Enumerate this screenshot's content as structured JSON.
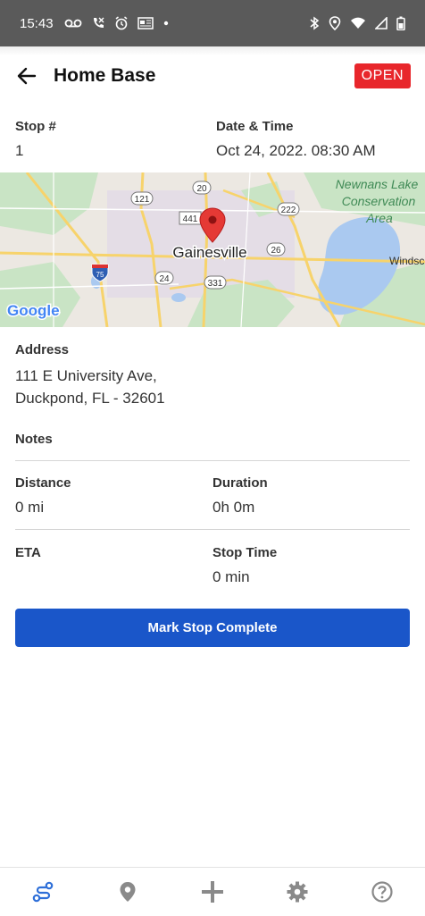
{
  "statusbar": {
    "time": "15:43"
  },
  "appbar": {
    "title": "Home Base",
    "status_badge": "OPEN"
  },
  "stop": {
    "label": "Stop #",
    "value": "1"
  },
  "datetime": {
    "label": "Date & Time",
    "value": "Oct 24, 2022. 08:30 AM"
  },
  "map": {
    "city": "Gainesville",
    "lake_label_1": "Newnans Lake",
    "lake_label_2": "Conservation",
    "lake_label_3": "Area",
    "place_right": "Windsc",
    "shields": [
      "121",
      "20",
      "441",
      "222",
      "26",
      "24",
      "331",
      "75"
    ],
    "logo": "Google"
  },
  "address": {
    "label": "Address",
    "line1": "111 E University Ave,",
    "line2": "Duckpond, FL - 32601"
  },
  "notes": {
    "label": "Notes"
  },
  "distance": {
    "label": "Distance",
    "value": "0 mi"
  },
  "duration": {
    "label": "Duration",
    "value": "0h 0m"
  },
  "eta": {
    "label": "ETA",
    "value": ""
  },
  "stop_time": {
    "label": "Stop Time",
    "value": "0 min"
  },
  "actions": {
    "complete_label": "Mark Stop Complete"
  },
  "nav": {
    "items": [
      {
        "icon": "route-icon",
        "active": true
      },
      {
        "icon": "location-pin-icon",
        "active": false
      },
      {
        "icon": "plus-icon",
        "active": false
      },
      {
        "icon": "gear-icon",
        "active": false
      },
      {
        "icon": "help-icon",
        "active": false
      }
    ]
  },
  "colors": {
    "accent": "#1a56c9",
    "badge": "#e8262b",
    "nav_active": "#2e6fd8",
    "nav_inactive": "#8a8a8a"
  }
}
